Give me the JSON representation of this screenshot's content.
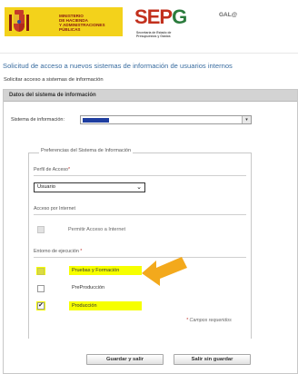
{
  "header": {
    "ministry_lines": [
      "Ministerio",
      "de Hacienda",
      "y Administraciones",
      "Públicas"
    ],
    "brand": {
      "s": "S",
      "e": "E",
      "p": "P",
      "g": "G"
    },
    "brand_sub_lines": [
      "Secretaría de Estado de",
      "Presupuestos y Gastos"
    ],
    "user_label": "GAL@"
  },
  "page": {
    "title": "Solicitud de acceso a nuevos sistemas de información de usuarios internos",
    "subtitle": "Solicitar acceso a sistemas de información"
  },
  "panel": {
    "header": "Datos del sistema de información",
    "system_label": "Sistema de información:",
    "fieldset_legend": "Preferencias del Sistema de Información",
    "perfil_label": "Perfil de Acceso",
    "perfil_value": "Usuario",
    "internet_label": "Acceso por Internet",
    "internet_option": "Permitir Acceso a Internet",
    "entorno_label": "Entorno de ejecución",
    "entorno_options": [
      {
        "label": "Pruebas y Formación",
        "checked": false,
        "disabled": true,
        "highlighted": true
      },
      {
        "label": "PreProducción",
        "checked": false,
        "disabled": false,
        "highlighted": false
      },
      {
        "label": "Producción",
        "checked": true,
        "disabled": false,
        "highlighted": true
      }
    ],
    "required_star": "*",
    "required_note": "Campos requeridos"
  },
  "buttons": {
    "save": "Guardar y salir",
    "cancel": "Salir sin guardar"
  },
  "colors": {
    "ministry_bg": "#f3d21b",
    "title_blue": "#3a6da0",
    "highlight": "#f6ff00",
    "arrow": "#f3a91c",
    "required": "#c0302a"
  }
}
